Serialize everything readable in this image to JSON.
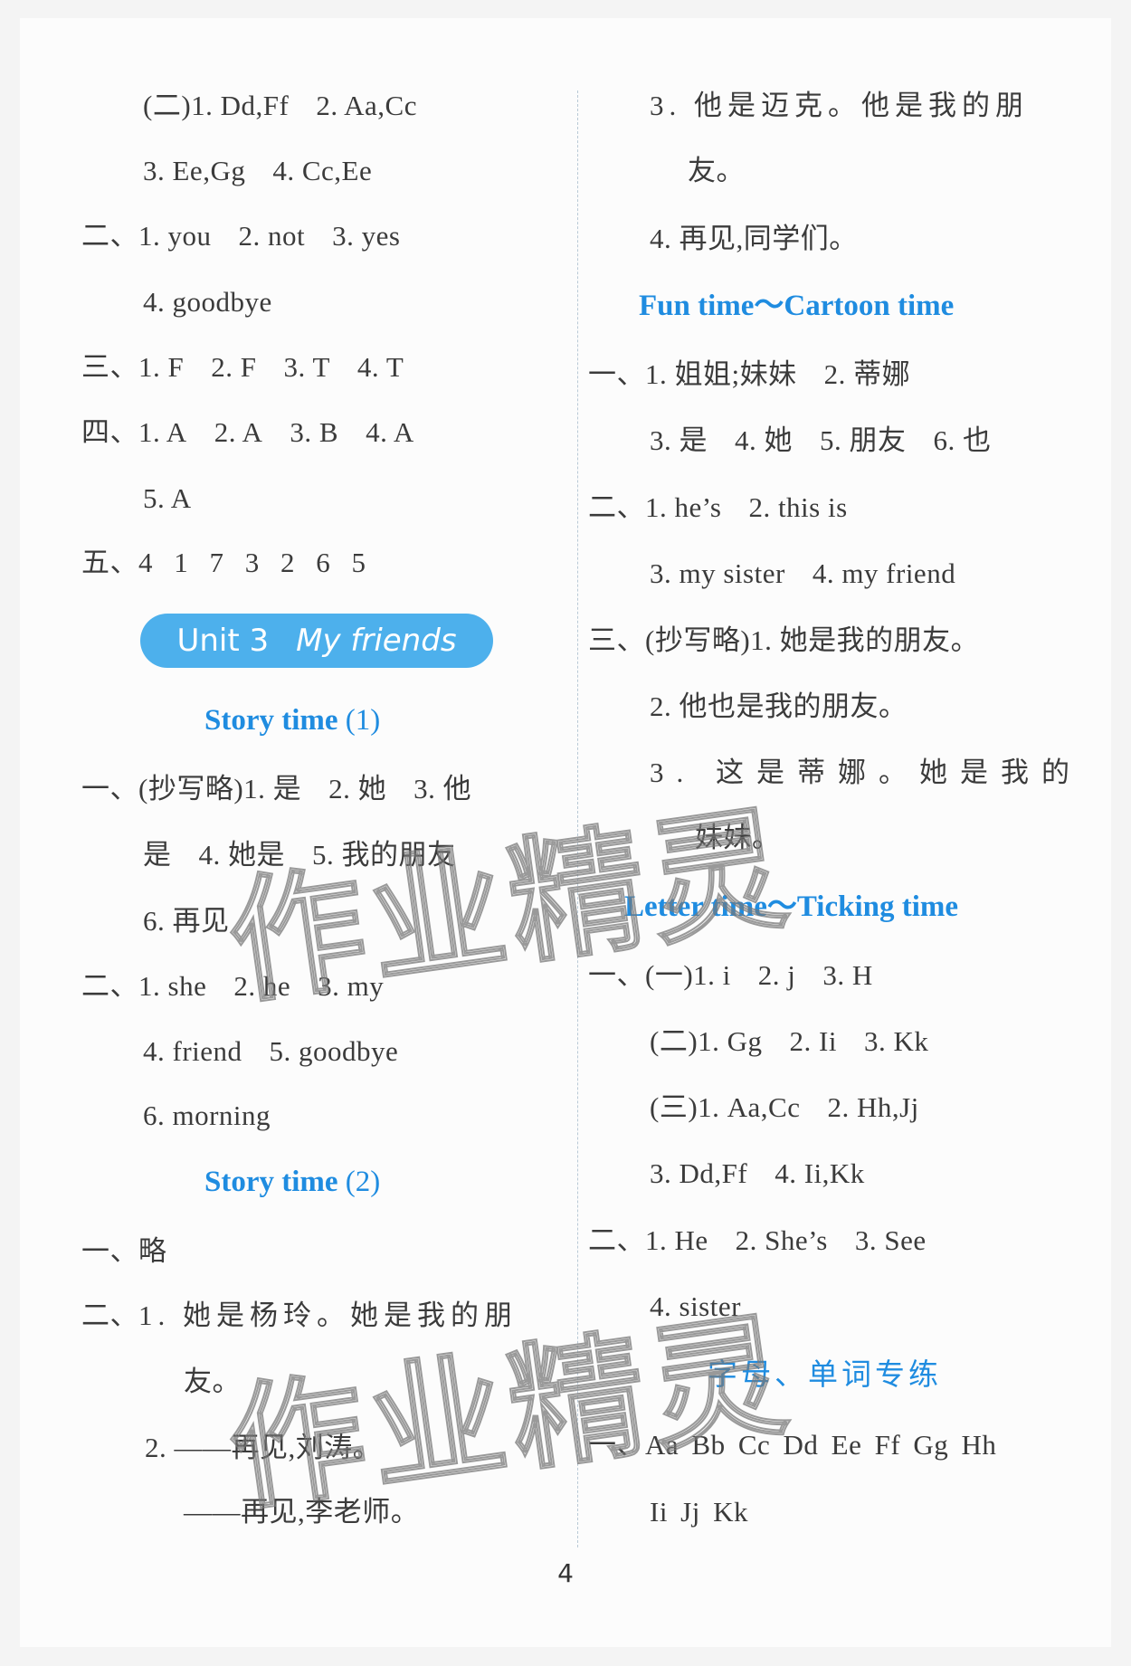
{
  "left_column": {
    "lines": [
      {
        "label": "",
        "items": [
          "(二)1. Dd,Ff",
          "2. Aa,Cc"
        ]
      },
      {
        "label": "",
        "items": [
          "3. Ee,Gg",
          "4. Cc,Ee"
        ]
      },
      {
        "label": "二、",
        "items": [
          "1. you",
          "2. not",
          "3. yes"
        ]
      },
      {
        "label": "",
        "items": [
          "4. goodbye"
        ]
      },
      {
        "label": "三、",
        "items": [
          "1. F",
          "2. F",
          "3. T",
          "4. T"
        ]
      },
      {
        "label": "四、",
        "items": [
          "1. A",
          "2. A",
          "3. B",
          "4. A"
        ]
      },
      {
        "label": "",
        "items": [
          "5. A"
        ]
      },
      {
        "label": "五、",
        "items": [
          "4 1 7 3 2 6 5"
        ]
      }
    ],
    "unit_banner": {
      "unit": "Unit 3",
      "title": "My friends"
    },
    "story_time_1": {
      "heading": "Story time",
      "heading_num": "(1)",
      "lines": [
        {
          "label": "一、",
          "items": [
            "(抄写略)1. 是",
            "2. 她",
            "3. 他"
          ]
        },
        {
          "label": "",
          "items": [
            "是",
            "4. 她是",
            "5. 我的朋友"
          ]
        },
        {
          "label": "",
          "items": [
            "6. 再见"
          ]
        },
        {
          "label": "二、",
          "items": [
            "1. she",
            "2. he",
            "3. my"
          ]
        },
        {
          "label": "",
          "items": [
            "4. friend",
            "5. goodbye"
          ]
        },
        {
          "label": "",
          "items": [
            "6. morning"
          ]
        }
      ]
    },
    "story_time_2": {
      "heading": "Story time",
      "heading_num": "(2)",
      "lines": [
        {
          "label": "一、",
          "items": [
            "略"
          ]
        },
        {
          "label": "二、",
          "items": [
            "1. 她是杨玲。她是我的朋"
          ]
        },
        {
          "label": "",
          "items": [
            "友。"
          ]
        },
        {
          "label": "",
          "items": [
            "2. ——再见,刘涛。"
          ]
        },
        {
          "label": "",
          "items": [
            "——再见,李老师。"
          ]
        }
      ]
    }
  },
  "right_column": {
    "lines": [
      {
        "label": "",
        "items": [
          "3. 他是迈克。他是我的朋"
        ]
      },
      {
        "label": "",
        "items": [
          "友。"
        ]
      },
      {
        "label": "",
        "items": [
          "4. 再见,同学们。"
        ]
      }
    ],
    "fun_time": {
      "heading": "Fun time～Cartoon time",
      "lines": [
        {
          "label": "一、",
          "items": [
            "1. 姐姐;妹妹",
            "2. 蒂娜"
          ]
        },
        {
          "label": "",
          "items": [
            "3. 是",
            "4. 她",
            "5. 朋友",
            "6. 也"
          ]
        },
        {
          "label": "二、",
          "items": [
            "1. he’s",
            "2. this is"
          ]
        },
        {
          "label": "",
          "items": [
            "3. my sister",
            "4. my friend"
          ]
        },
        {
          "label": "三、",
          "items": [
            "(抄写略)1. 她是我的朋友。"
          ]
        },
        {
          "label": "",
          "items": [
            "2. 他也是我的朋友。"
          ]
        },
        {
          "label": "",
          "items": [
            "3. 这是蒂娜。她是我的"
          ]
        },
        {
          "label": "",
          "items": [
            "妹妹。"
          ]
        }
      ]
    },
    "letter_time": {
      "heading": "Letter time～Ticking time",
      "lines": [
        {
          "label": "一、",
          "items": [
            "(一)1. i",
            "2. j",
            "3. H"
          ]
        },
        {
          "label": "",
          "items": [
            "(二)1. Gg",
            "2. Ii",
            "3. Kk"
          ]
        },
        {
          "label": "",
          "items": [
            "(三)1. Aa,Cc",
            "2. Hh,Jj"
          ]
        },
        {
          "label": "",
          "items": [
            "3. Dd,Ff",
            "4. Ii,Kk"
          ]
        },
        {
          "label": "二、",
          "items": [
            "1. He",
            "2. She’s",
            "3. See"
          ]
        },
        {
          "label": "",
          "items": [
            "4. sister"
          ]
        }
      ]
    },
    "letters_words": {
      "heading": "字母、单词专练",
      "lines": [
        {
          "label": "一、",
          "items": [
            "Aa Bb Cc Dd Ee Ff Gg Hh"
          ]
        },
        {
          "label": "",
          "items": [
            "Ii Jj Kk"
          ]
        }
      ]
    }
  },
  "watermark": "作业精灵",
  "page_number": "4",
  "colors": {
    "accent_blue": "#1f8ce0",
    "banner_blue": "#4db0ec",
    "text": "#3b3b3b"
  }
}
